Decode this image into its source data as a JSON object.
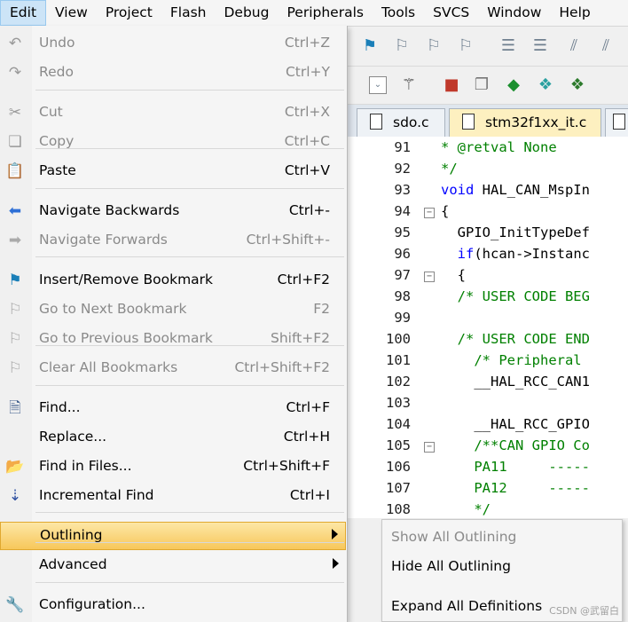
{
  "menubar": {
    "items": [
      "Edit",
      "View",
      "Project",
      "Flash",
      "Debug",
      "Peripherals",
      "Tools",
      "SVCS",
      "Window",
      "Help"
    ]
  },
  "tabs": [
    {
      "label": "sdo.c"
    },
    {
      "label": "stm32f1xx_it.c"
    }
  ],
  "editor": {
    "lines": [
      {
        "num": "91",
        "code": "* @retval None",
        "style": "cm"
      },
      {
        "num": "92",
        "code": "*/",
        "style": "cm"
      },
      {
        "num": "93",
        "code": "void HAL_CAN_MspIn",
        "style": "kw-first"
      },
      {
        "num": "94",
        "code": "{",
        "style": "plain"
      },
      {
        "num": "95",
        "code": "  GPIO_InitTypeDef",
        "style": "plain"
      },
      {
        "num": "96",
        "code": "  if(hcan->Instanc",
        "style": "kw-first"
      },
      {
        "num": "97",
        "code": "  {",
        "style": "plain"
      },
      {
        "num": "98",
        "code": "  /* USER CODE BEG",
        "style": "cm"
      },
      {
        "num": "99",
        "code": "",
        "style": "plain"
      },
      {
        "num": "100",
        "code": "  /* USER CODE END",
        "style": "cm"
      },
      {
        "num": "101",
        "code": "    /* Peripheral ",
        "style": "cm"
      },
      {
        "num": "102",
        "code": "    __HAL_RCC_CAN1",
        "style": "plain"
      },
      {
        "num": "103",
        "code": "",
        "style": "plain"
      },
      {
        "num": "104",
        "code": "    __HAL_RCC_GPIO",
        "style": "plain"
      },
      {
        "num": "105",
        "code": "    /**CAN GPIO Co",
        "style": "cm"
      },
      {
        "num": "106",
        "code": "    PA11     -----",
        "style": "cm"
      },
      {
        "num": "107",
        "code": "    PA12     -----",
        "style": "cm"
      },
      {
        "num": "108",
        "code": "    */",
        "style": "cm"
      }
    ]
  },
  "edit_menu": {
    "items": [
      {
        "label": "Undo",
        "shortcut": "Ctrl+Z",
        "icon": "undo-icon",
        "disabled": true
      },
      {
        "label": "Redo",
        "shortcut": "Ctrl+Y",
        "icon": "redo-icon",
        "disabled": true
      },
      {
        "label": "Cut",
        "shortcut": "Ctrl+X",
        "icon": "scissors-icon",
        "disabled": true
      },
      {
        "label": "Copy",
        "shortcut": "Ctrl+C",
        "icon": "copy-icon",
        "disabled": true
      },
      {
        "label": "Paste",
        "shortcut": "Ctrl+V",
        "icon": "paste-icon",
        "disabled": false
      },
      {
        "label": "Navigate Backwards",
        "shortcut": "Ctrl+-",
        "icon": "arrow-left-icon",
        "disabled": false
      },
      {
        "label": "Navigate Forwards",
        "shortcut": "Ctrl+Shift+-",
        "icon": "arrow-right-icon",
        "disabled": true
      },
      {
        "label": "Insert/Remove Bookmark",
        "shortcut": "Ctrl+F2",
        "icon": "bookmark-flag-icon",
        "disabled": false
      },
      {
        "label": "Go to Next Bookmark",
        "shortcut": "F2",
        "icon": "next-bookmark-icon",
        "disabled": true
      },
      {
        "label": "Go to Previous Bookmark",
        "shortcut": "Shift+F2",
        "icon": "previous-bookmark-icon",
        "disabled": true
      },
      {
        "label": "Clear All Bookmarks",
        "shortcut": "Ctrl+Shift+F2",
        "icon": "clear-bookmarks-icon",
        "disabled": true
      },
      {
        "label": "Find...",
        "shortcut": "Ctrl+F",
        "icon": "find-icon",
        "disabled": false
      },
      {
        "label": "Replace...",
        "shortcut": "Ctrl+H",
        "icon": "",
        "disabled": false
      },
      {
        "label": "Find in Files...",
        "shortcut": "Ctrl+Shift+F",
        "icon": "find-in-files-icon",
        "disabled": false
      },
      {
        "label": "Incremental Find",
        "shortcut": "Ctrl+I",
        "icon": "incremental-find-icon",
        "disabled": false
      },
      {
        "label": "Outlining",
        "shortcut": "",
        "icon": "",
        "disabled": false,
        "submenu": true,
        "highlighted": true
      },
      {
        "label": "Advanced",
        "shortcut": "",
        "icon": "",
        "disabled": false,
        "submenu": true
      },
      {
        "label": "Configuration...",
        "shortcut": "",
        "icon": "wrench-icon",
        "disabled": false
      }
    ]
  },
  "outlining_submenu": {
    "items": [
      {
        "label": "Show All Outlining",
        "disabled": true
      },
      {
        "label": "Hide All Outlining",
        "disabled": false
      },
      {
        "label": "Expand All Definitions",
        "disabled": false
      }
    ]
  },
  "watermark": "CSDN @武留白",
  "colors": {
    "highlight": "#f7c75a",
    "keyword": "#0000ff",
    "comment": "#008000",
    "active_tab": "#fdf0c0"
  }
}
